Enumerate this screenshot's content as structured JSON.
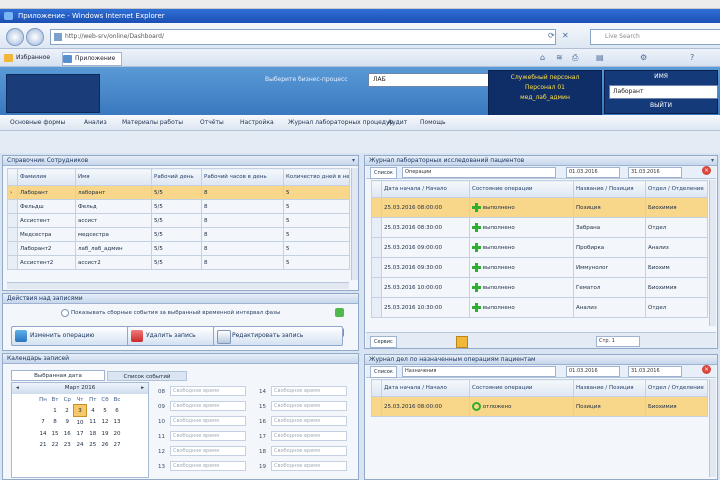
{
  "browser": {
    "title": "Приложение - Windows Internet Explorer",
    "address": "http://web-srv/online/Dashboard/",
    "search_placeholder": "Live Search",
    "favorites_label": "Избранное",
    "tab_label": "Приложение"
  },
  "header": {
    "code_label": "Выберите бизнес-процесс",
    "code_value": "ЛАБ",
    "info_lines": [
      "Служебный персонал",
      "Персонал 01",
      "мед_лаб_админ"
    ],
    "right_title": "ИМЯ",
    "right_select": "Лаборант",
    "right_bottom": "ВЫЙТИ"
  },
  "menu": [
    "Основные формы",
    "Анализ",
    "Материалы работы",
    "Отчёты",
    "Настройка",
    "Журнал лабораторных процедур",
    "Аудит",
    "Помощь"
  ],
  "left_panel": {
    "title": "Справочник Сотрудников",
    "columns": [
      "Фамилия",
      "Имя",
      "Рабочий день",
      "Рабочий часов в день",
      "Количество дней в неделю"
    ],
    "rows": [
      [
        "Лаборант",
        "лаборант",
        "5/5",
        "8",
        "5"
      ],
      [
        "Фельдш",
        "Фельд",
        "5/5",
        "8",
        "5"
      ],
      [
        "Ассистент",
        "ассист",
        "5/5",
        "8",
        "5"
      ],
      [
        "Медсестра",
        "медсестра",
        "5/5",
        "8",
        "5"
      ],
      [
        "Лаборант2",
        "лаб_лаб_админ",
        "5/5",
        "8",
        "5"
      ],
      [
        "Ассистент2",
        "ассист2",
        "5/5",
        "8",
        "5"
      ]
    ]
  },
  "actions_panel": {
    "title": "Действия над записями",
    "option_text": "Показывать сборные события за выбранный временной интервал фазы",
    "btn1": "Изменить операцию",
    "btn2": "Удалить запись",
    "btn3": "Редактировать запись"
  },
  "calendar_panel": {
    "title": "Календарь записей",
    "tab1": "Выбранная дата",
    "tab2": "Список событий",
    "month": "Март 2016",
    "weekdays": [
      "Пн",
      "Вт",
      "Ср",
      "Чт",
      "Пт",
      "Сб",
      "Вс"
    ],
    "weeks": [
      [
        "",
        "1",
        "2",
        "3",
        "4",
        "5",
        "6"
      ],
      [
        "7",
        "8",
        "9",
        "10",
        "11",
        "12",
        "13"
      ],
      [
        "14",
        "15",
        "16",
        "17",
        "18",
        "19",
        "20"
      ],
      [
        "21",
        "22",
        "23",
        "24",
        "25",
        "26",
        "27"
      ]
    ],
    "selected_day": "3",
    "slot_text": "Свободное время",
    "slots_left": [
      "08",
      "09",
      "10",
      "11",
      "12",
      "13"
    ],
    "slots_right": [
      "14",
      "15",
      "16",
      "17",
      "18",
      "19"
    ]
  },
  "right_top": {
    "title": "Журнал лабораторных исследований пациентов",
    "tab": "Список",
    "filter": "Операции",
    "date_from": "01.03.2016",
    "date_to": "31.03.2016",
    "columns": [
      "Дата начала / Начало",
      "Состояние операции",
      "Название / Позиция",
      "Отдел / Отделение"
    ],
    "rows": [
      [
        "25.03.2016 08:00:00",
        "выполнено",
        "Позиция",
        "Биохимия"
      ],
      [
        "25.03.2016 08:30:00",
        "выполнено",
        "Забрана",
        "Отдел"
      ],
      [
        "25.03.2016 09:00:00",
        "выполнено",
        "Пробирка",
        "Анализ"
      ],
      [
        "25.03.2016 09:30:00",
        "выполнено",
        "Иммунолог",
        "Биохим"
      ],
      [
        "25.03.2016 10:00:00",
        "выполнено",
        "Гематол",
        "Биохимия"
      ],
      [
        "25.03.2016 10:30:00",
        "выполнено",
        "Анализ",
        "Отдел"
      ]
    ],
    "footer_btn": "Сервис",
    "footer_page": "Стр. 1"
  },
  "right_bottom": {
    "title": "Журнал дел по назначенным операциям пациентам",
    "tab": "Список",
    "filter": "Назначения",
    "date_from": "01.03.2016",
    "date_to": "31.03.2016",
    "columns": [
      "Дата начала / Начало",
      "Состояние операции",
      "Название / Позиция",
      "Отдел / Отделение"
    ],
    "rows": [
      [
        "25.03.2016 08:00:00",
        "отложено",
        "Позиция",
        "Биохимия"
      ]
    ]
  }
}
